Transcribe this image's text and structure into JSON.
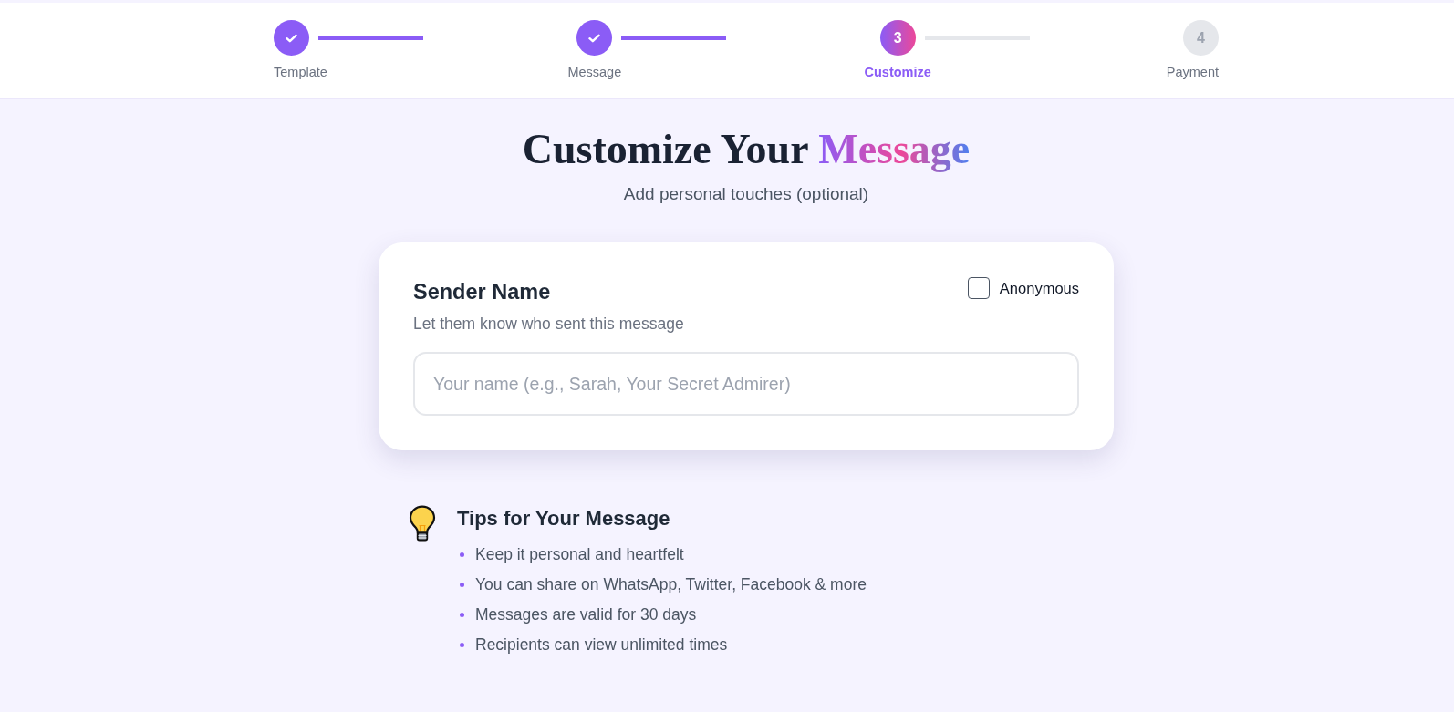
{
  "stepper": {
    "steps": [
      {
        "label": "Template",
        "completed": true,
        "selected": false
      },
      {
        "label": "Message",
        "completed": true,
        "selected": false
      },
      {
        "label": "Customize",
        "number": "3",
        "completed": false,
        "selected": true
      },
      {
        "label": "Payment",
        "number": "4",
        "completed": false,
        "selected": false
      }
    ]
  },
  "header": {
    "title": "Customize Your",
    "title_highlight": "Message",
    "subtitle": "Add personal touches (optional)"
  },
  "sender_card": {
    "title": "Sender Name",
    "description": "Let them know who sent this message",
    "anonymous": {
      "label": "Anonymous",
      "checked": false
    },
    "name_field": {
      "placeholder": "Your name (e.g., Sarah, Your Secret Admirer)"
    }
  },
  "tips": {
    "title": "Tips for Your Message",
    "items": [
      "Keep it personal and heartfelt",
      "You can share on WhatsApp, Twitter, Facebook & more",
      "Messages are valid for 30 days",
      "Recipients can view unlimited times"
    ]
  }
}
